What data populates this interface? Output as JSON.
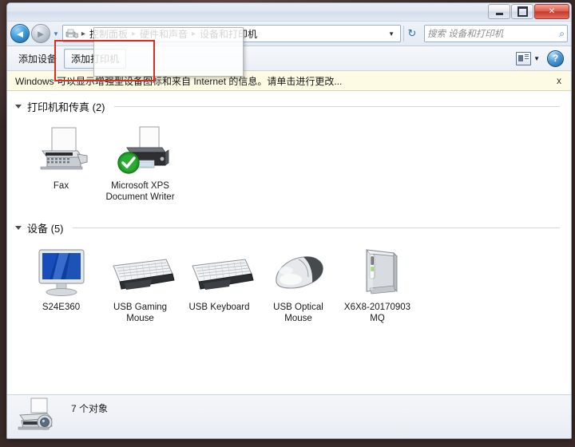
{
  "window": {
    "controls": {
      "minimize_label": "Minimize",
      "maximize_label": "Restore",
      "close_label": "✕"
    }
  },
  "nav": {
    "back_glyph": "◄",
    "forward_glyph": "►",
    "history_glyph": "▼",
    "refresh_glyph": "↻",
    "dropdown_glyph": "▼",
    "breadcrumbs": [
      {
        "label": "控制面板"
      },
      {
        "label": "硬件和声音"
      },
      {
        "label": "设备和打印机"
      }
    ],
    "separator": "▸"
  },
  "search": {
    "placeholder": "搜索 设备和打印机",
    "icon_glyph": "⌕"
  },
  "toolbar": {
    "add_device_label": "添加设备",
    "add_printer_label": "添加打印机",
    "caret_glyph": "▼",
    "help_label": "?"
  },
  "infobar": {
    "message": "Windows 可以显示增强型设备图标和来自 Internet 的信息。请单击进行更改...",
    "dismiss_label": "x"
  },
  "groups": [
    {
      "title": "打印机和传真 (2)",
      "items": [
        {
          "label": "Fax",
          "icon": "fax-icon"
        },
        {
          "label": "Microsoft XPS Document Writer",
          "icon": "printer-icon",
          "badge": "default-check"
        }
      ]
    },
    {
      "title": "设备 (5)",
      "items": [
        {
          "label": "S24E360",
          "icon": "monitor-icon"
        },
        {
          "label": "USB Gaming Mouse",
          "icon": "keyboard-icon"
        },
        {
          "label": "USB Keyboard",
          "icon": "keyboard-icon"
        },
        {
          "label": "USB Optical Mouse",
          "icon": "mouse-icon"
        },
        {
          "label": "X6X8-20170903 MQ",
          "icon": "drive-icon"
        }
      ]
    }
  ],
  "status": {
    "object_count_text": "7 个对象",
    "icon": "printer-scanner-icon"
  },
  "colors": {
    "annotation": "#e02b1e",
    "infobar_bg": "#fdfbe3",
    "close_button": "#c53a2a",
    "default_badge": "#1f9c28"
  }
}
